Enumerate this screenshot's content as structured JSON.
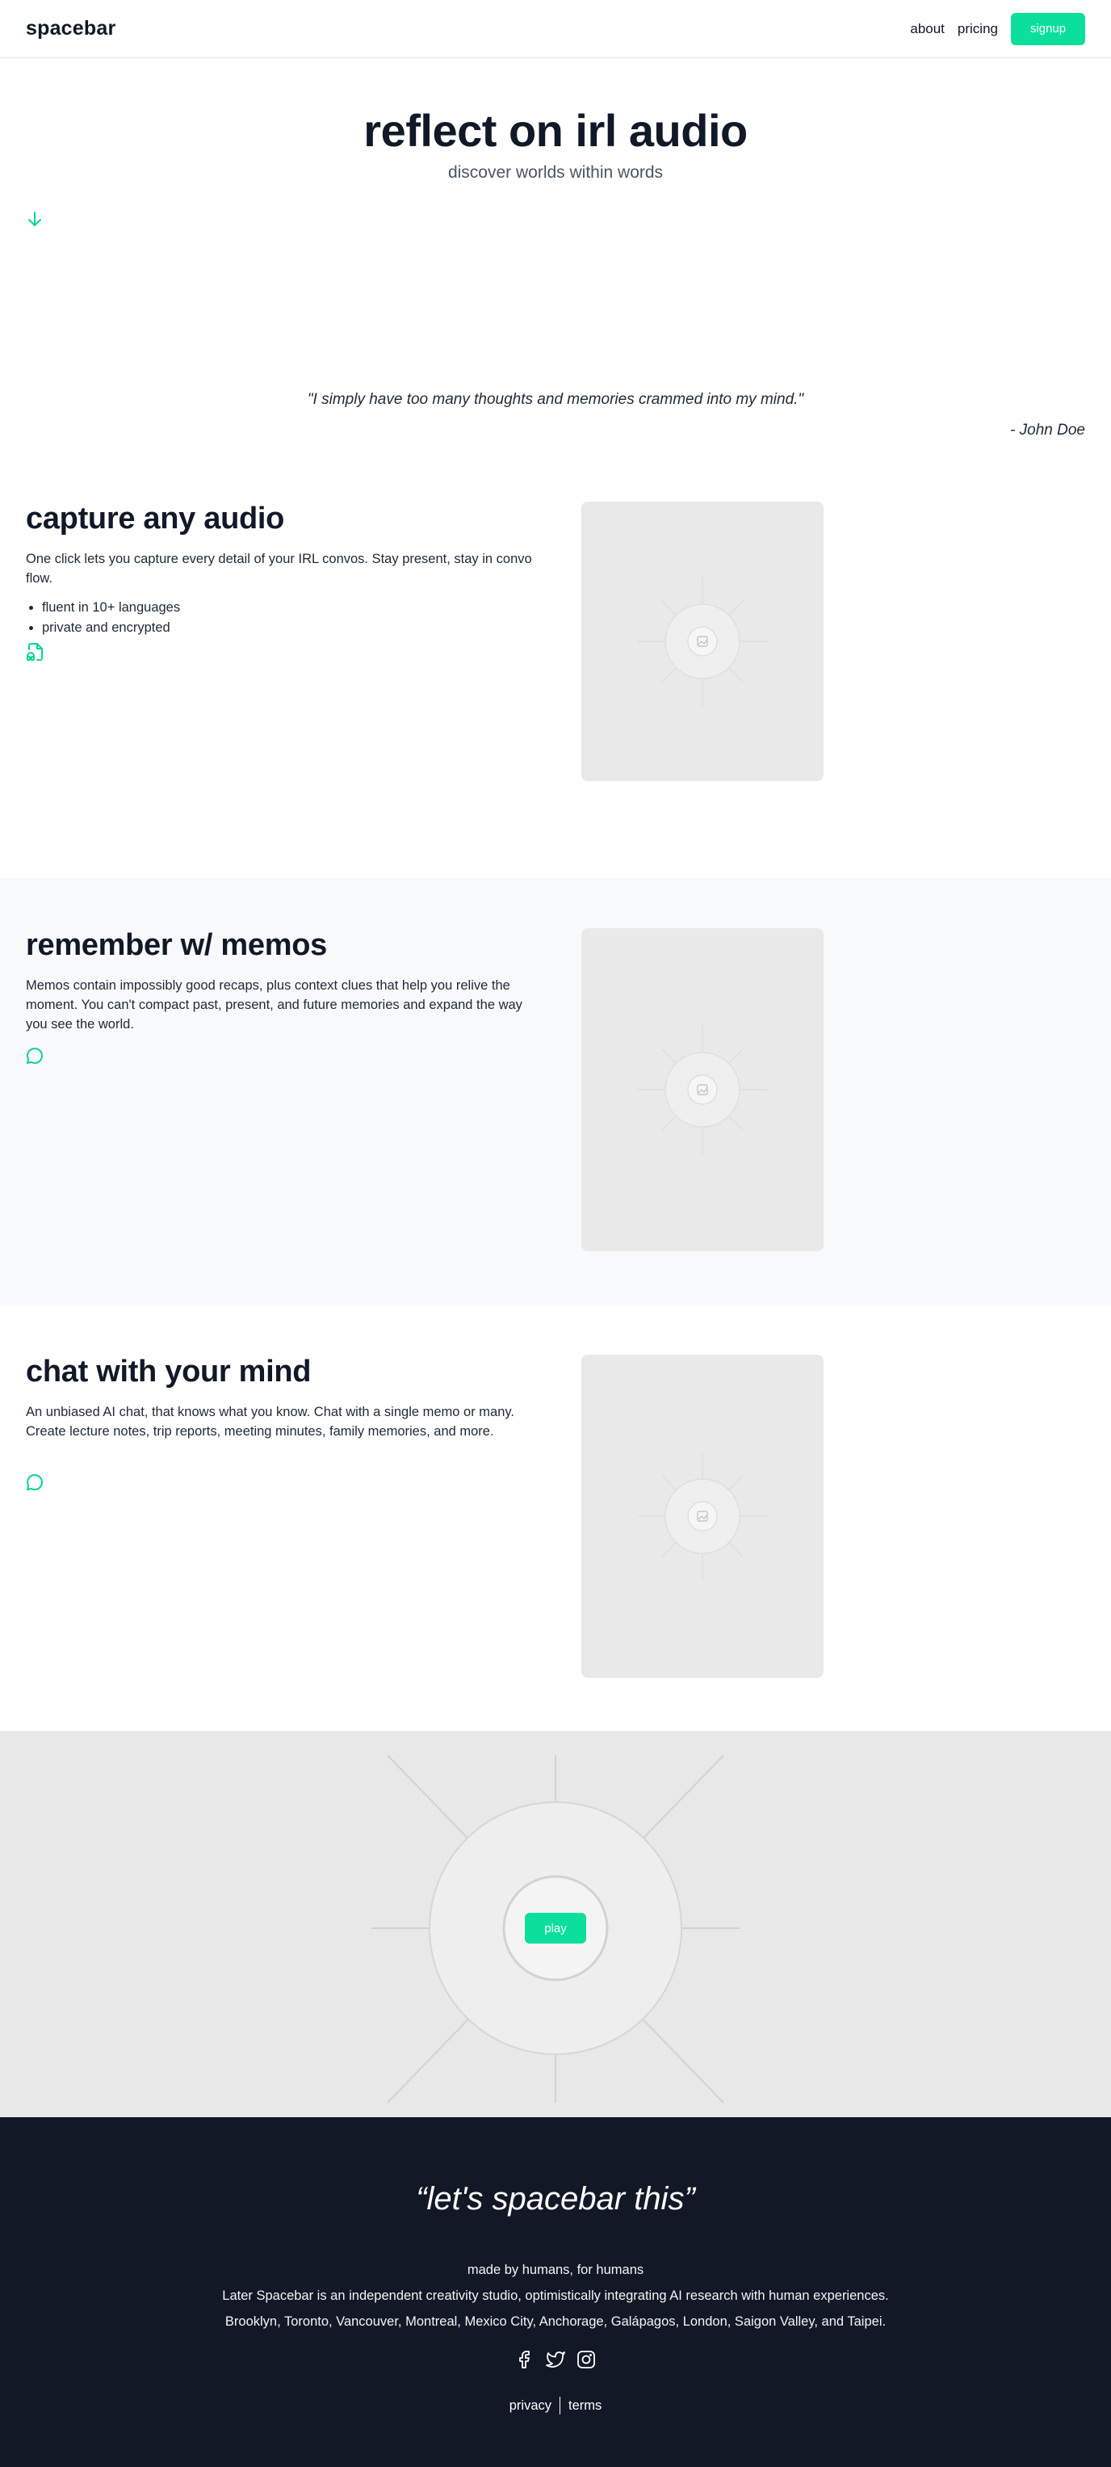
{
  "header": {
    "logo": "spacebar",
    "nav": [
      {
        "label": "about"
      },
      {
        "label": "pricing"
      }
    ],
    "signup_label": "signup"
  },
  "hero": {
    "title": "reflect on irl audio",
    "subtitle": "discover worlds within words",
    "scroll_icon": "arrow-down-icon"
  },
  "quote": {
    "text": "\"I simply have too many thoughts and memories crammed into my mind.\"",
    "author": "- John Doe"
  },
  "features": [
    {
      "title": "capture any audio",
      "description": "One click lets you capture every detail of your IRL convos. Stay present, stay in convo flow.",
      "bullets": [
        "fluent in 10+ languages",
        "private and encrypted"
      ],
      "icon": "audio-file-icon"
    },
    {
      "title": "remember w/ memos",
      "description": "Memos contain impossibly good recaps, plus context clues that help you relive the moment. You can't compact past, present, and future memories and expand the way you see the world.",
      "icon": "chat-bubble-icon"
    },
    {
      "title": "chat with your mind",
      "description": "An unbiased AI chat, that knows what you know. Chat with a single memo or many. Create lecture notes, trip reports, meeting minutes, family memories, and more.",
      "icon": "chat-bubble-icon"
    }
  ],
  "play": {
    "label": "play"
  },
  "footer": {
    "tagline": "“let's spacebar this”",
    "made_by": "made by humans, for humans",
    "about": "Later Spacebar is an independent creativity studio, optimistically integrating AI research with human experiences.",
    "cities": "Brooklyn, Toronto, Vancouver, Montreal, Mexico City, Anchorage, Galápagos, London, Saigon Valley, and Taipei.",
    "socials": [
      "facebook-icon",
      "twitter-icon",
      "instagram-icon"
    ],
    "privacy": "privacy",
    "terms": "terms"
  },
  "colors": {
    "accent": "#0be09b",
    "dark": "#131827",
    "text": "#111827",
    "placeholder": "#e9e9e9",
    "section_gray": "#f8f9fb"
  }
}
